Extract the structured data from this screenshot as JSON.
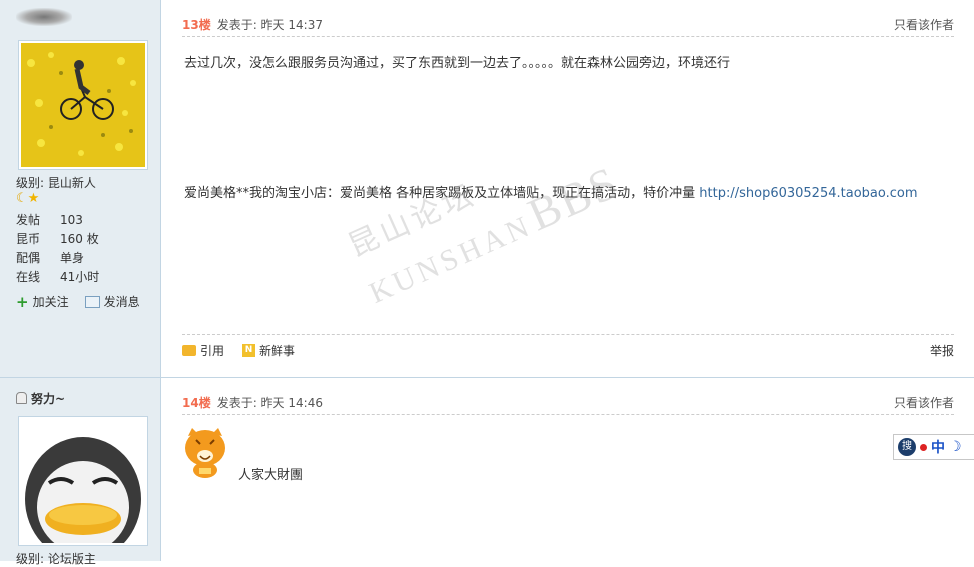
{
  "posts": [
    {
      "username": "",
      "level_label": "级别: 昆山新人",
      "stats": [
        {
          "key": "发帖",
          "value": "103"
        },
        {
          "key": "昆币",
          "value": "160 枚"
        },
        {
          "key": "配偶",
          "value": "单身"
        },
        {
          "key": "在线",
          "value": "41小时"
        }
      ],
      "follow_label": "加关注",
      "message_label": "发消息",
      "floor": "13楼",
      "posted": "发表于: 昨天 14:37",
      "author_only": "只看该作者",
      "content": "去过几次，没怎么跟服务员沟通过，买了东西就到一边去了。。。。。就在森林公园旁边，环境还行",
      "signature": "爱尚美格**我的淘宝小店：爱尚美格 各种居家踢板及立体墙贴，现正在搞活动，特价冲量",
      "signature_link": "http://shop60305254.taobao.com",
      "quote_label": "引用",
      "news_label": "新鲜事",
      "report_label": "举报"
    },
    {
      "username": "努力~",
      "level_label": "级别: 论坛版主",
      "floor": "14楼",
      "posted": "发表于: 昨天 14:46",
      "author_only": "只看该作者",
      "content": "人家大財團"
    }
  ],
  "watermark": {
    "line1": "昆山论坛",
    "line2": "KUNSHAN",
    "line3": "BBS"
  },
  "ime": {
    "logo": "搜",
    "mode": "中"
  }
}
